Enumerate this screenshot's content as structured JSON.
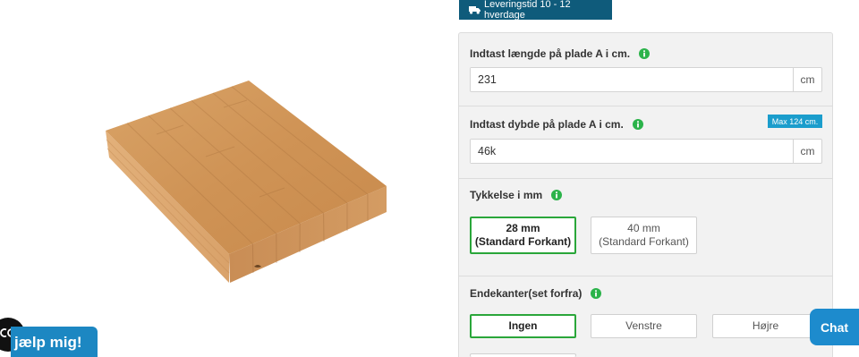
{
  "delivery_badge": {
    "icon": "truck-icon",
    "text": "Leveringstid 10 - 12 hverdage"
  },
  "length_field": {
    "label": "Indtast længde på plade A i cm.",
    "info_icon": "info-icon",
    "value": "231",
    "unit": "cm"
  },
  "depth_field": {
    "label": "Indtast dybde på plade A i cm.",
    "info_icon": "info-icon",
    "max_badge": "Max 124 cm.",
    "value": "46k",
    "unit": "cm"
  },
  "thickness": {
    "label": "Tykkelse i mm",
    "info_icon": "info-icon",
    "options": [
      {
        "size": "28 mm",
        "note": "(Standard Forkant)",
        "selected": true
      },
      {
        "size": "40 mm",
        "note": "(Standard Forkant)",
        "selected": false
      }
    ]
  },
  "end_edges": {
    "label": "Endekanter(set forfra)",
    "info_icon": "info-icon",
    "options": [
      {
        "label": "Ingen",
        "selected": true
      },
      {
        "label": "Venstre",
        "selected": false
      },
      {
        "label": "Højre",
        "selected": false
      }
    ]
  },
  "help_widget": {
    "icon": "accessibility-icon",
    "label": "jælp mig!"
  },
  "chat": {
    "label": "Chat"
  },
  "colors": {
    "badge_bg": "#0f5b7b",
    "info_icon": "#2bb34a",
    "selected_border": "#2aa63a",
    "max_badge_bg": "#1b9dcc",
    "help_button_bg": "#1c87c2",
    "chat_button_bg": "#1d8bcd",
    "panel_bg": "#f2f2f2"
  }
}
